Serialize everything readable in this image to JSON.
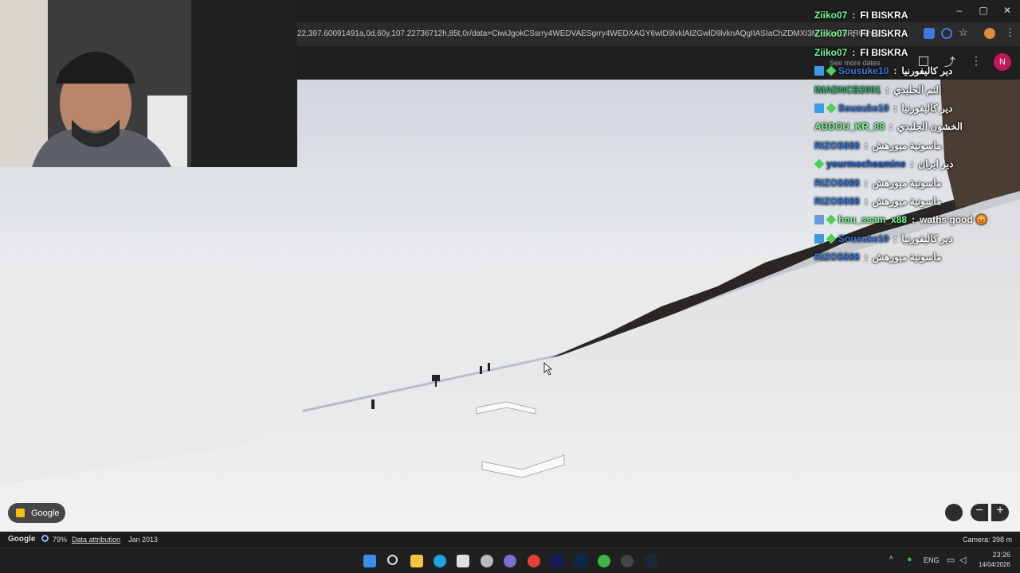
{
  "browser": {
    "url": "22,397.60091491a,0d,60y,107.22736712h,85t,0r/data=CiwiJgokCSsrry4WEDVAESgrry4WEDXAGY6wlD9lvklAIZGwlD9lvknAQgIIASIaChZDMXI3MTY1eE9RR09hVjl..."
  },
  "streetview": {
    "see_more_dates": "See more dates",
    "google_chip": "Google",
    "google_logo": "Google",
    "loading_pct": "79%",
    "data_attribution": "Data attribution",
    "capture_date": "Jan 2013",
    "camera": "Camera: 398 m",
    "avatar_letter": "N"
  },
  "chat": [
    {
      "user": "Ziiko07",
      "msg": "FI BISKRA",
      "color": "#7CFC9A",
      "badges": []
    },
    {
      "user": "Ziiko07",
      "msg": "FI BISKRA",
      "color": "#7CFC9A",
      "badges": []
    },
    {
      "user": "Ziiko07",
      "msg": "FI BISKRA",
      "color": "#7CFC9A",
      "badges": []
    },
    {
      "user": "Sousuke10",
      "msg": "دير كاليفورنيا",
      "color": "#3B7BE0",
      "badges": [
        "cube",
        "diamond"
      ]
    },
    {
      "user": "IMADNCB2001",
      "msg": "النم الجليدي",
      "color": "#2FB36B",
      "badges": []
    },
    {
      "user": "Sousuke10",
      "msg": "دير كاليفورنيا",
      "color": "#3B7BE0",
      "badges": [
        "cube",
        "diamond"
      ]
    },
    {
      "user": "ABDOU_KR_88",
      "msg": "الخشون الجليدي",
      "color": "#7CFC9A",
      "badges": []
    },
    {
      "user": "RIZOS888",
      "msg": "ماسونية ميورهش",
      "color": "#3B7BE0",
      "badges": []
    },
    {
      "user": "yourmocheamine",
      "msg": "دير ايران",
      "color": "#1E63D6",
      "badges": [
        "diamond"
      ]
    },
    {
      "user": "RIZOS888",
      "msg": "ماسونية ميورهش",
      "color": "#3B7BE0",
      "badges": []
    },
    {
      "user": "RIZOS888",
      "msg": "ماسونية ميورهش",
      "color": "#3B7BE0",
      "badges": []
    },
    {
      "user": "hou_ssam_x88",
      "msg": "waths good 😡",
      "color": "#7CFC9A",
      "badges": [
        "sub",
        "diamond"
      ]
    },
    {
      "user": "Sousuke10",
      "msg": "دير كاليفورنيا",
      "color": "#3B7BE0",
      "badges": [
        "cube",
        "diamond"
      ]
    },
    {
      "user": "RIZOS888",
      "msg": "ماسونية ميورهش",
      "color": "#3B7BE0",
      "badges": []
    }
  ],
  "taskbar": {
    "lang": "ENG",
    "time": "23:26",
    "date": "14/04/2026"
  }
}
